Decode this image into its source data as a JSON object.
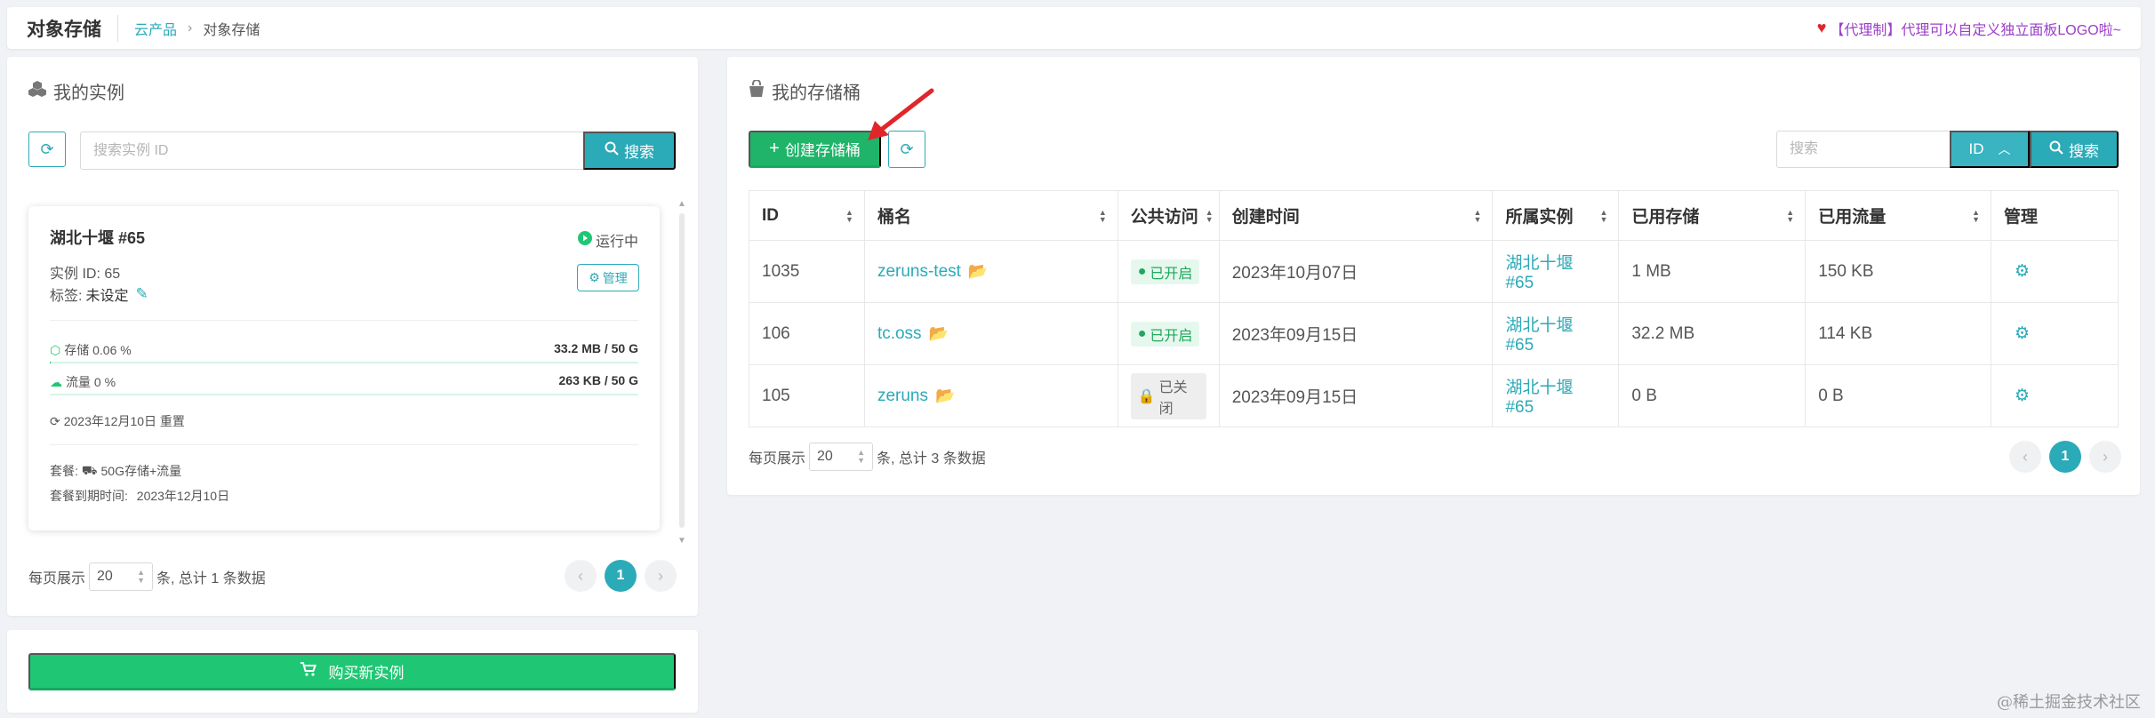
{
  "header": {
    "title": "对象存储",
    "breadcrumb": [
      "云产品",
      "对象存储"
    ],
    "notice": "【代理制】代理可以自定义独立面板LOGO啦~",
    "notice_color": "#9b3fc8"
  },
  "instances_panel": {
    "title": "我的实例",
    "search_placeholder": "搜索实例 ID",
    "search_label": "搜索",
    "card": {
      "name": "湖北十堰 #65",
      "status": "运行中",
      "instance_id_label": "实例 ID: 65",
      "tag_label": "标签:",
      "tag_value": "未设定",
      "manage_label": "管理",
      "storage_label": "存储 0.06 %",
      "storage_value": "33.2 MB / 50 G",
      "storage_progress": 0.06,
      "traffic_label": "流量 0 %",
      "traffic_value": "263 KB / 50 G",
      "traffic_progress": 0,
      "reset_label": "2023年12月10日 重置",
      "plan_label": "套餐:",
      "plan_value": "50G存储+流量",
      "expire_label": "套餐到期时间:",
      "expire_value": "2023年12月10日"
    },
    "pager": {
      "prefix": "每页展示",
      "size": "20",
      "suffix": "条, 总计 1 条数据",
      "current_page": "1"
    }
  },
  "buy_button": "购买新实例",
  "buckets_panel": {
    "title": "我的存储桶",
    "create_label": "创建存储桶",
    "search_placeholder": "搜索",
    "field_select": "ID",
    "search_label": "搜索",
    "columns": [
      "ID",
      "桶名",
      "公共访问",
      "创建时间",
      "所属实例",
      "已用存储",
      "已用流量",
      "管理"
    ],
    "rows": [
      {
        "id": "1035",
        "name": "zeruns-test",
        "access": "已开启",
        "access_on": true,
        "created": "2023年10月07日",
        "instance": "湖北十堰 #65",
        "storage": "1 MB",
        "traffic": "150 KB"
      },
      {
        "id": "106",
        "name": "tc.oss",
        "access": "已开启",
        "access_on": true,
        "created": "2023年09月15日",
        "instance": "湖北十堰 #65",
        "storage": "32.2 MB",
        "traffic": "114 KB"
      },
      {
        "id": "105",
        "name": "zeruns",
        "access": "已关闭",
        "access_on": false,
        "created": "2023年09月15日",
        "instance": "湖北十堰 #65",
        "storage": "0 B",
        "traffic": "0 B"
      }
    ],
    "pager": {
      "prefix": "每页展示",
      "size": "20",
      "suffix": "条, 总计 3 条数据",
      "current_page": "1"
    }
  },
  "watermark": "@稀土掘金技术社区",
  "colors": {
    "accent": "#2baab8",
    "green": "#1fc774",
    "arrow": "#e0262b"
  }
}
